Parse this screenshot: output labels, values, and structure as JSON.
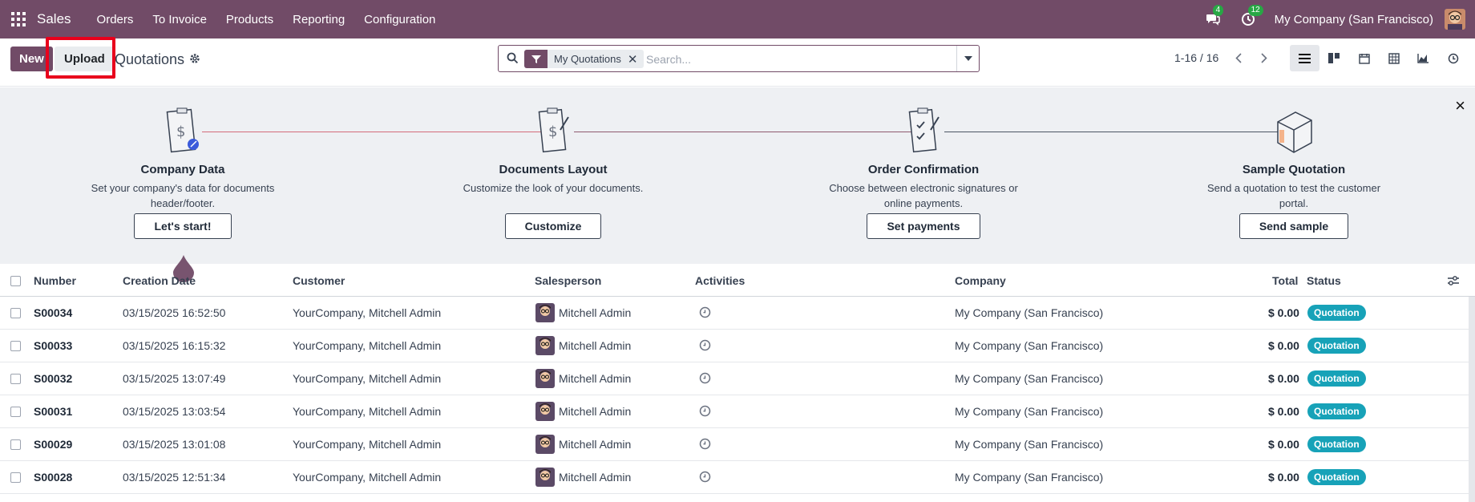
{
  "navbar": {
    "app_name": "Sales",
    "menu": [
      "Orders",
      "To Invoice",
      "Products",
      "Reporting",
      "Configuration"
    ],
    "messages_count": "4",
    "activities_count": "12",
    "company": "My Company (San Francisco)",
    "icons": [
      "apps-grid-icon",
      "chat-icon",
      "clock-icon",
      "avatar"
    ]
  },
  "control": {
    "new_label": "New",
    "upload_label": "Upload",
    "title": "Quotations",
    "search": {
      "facet": "My Quotations",
      "placeholder": "Search..."
    },
    "pager": "1-16 / 16",
    "views": [
      "list-view-icon",
      "kanban-view-icon",
      "calendar-view-icon",
      "pivot-view-icon",
      "graph-view-icon",
      "activity-view-icon"
    ]
  },
  "onboarding": {
    "steps": [
      {
        "title": "Company Data",
        "desc": "Set your company's data for documents header/footer.",
        "button": "Let's start!"
      },
      {
        "title": "Documents Layout",
        "desc": "Customize the look of your documents.",
        "button": "Customize"
      },
      {
        "title": "Order Confirmation",
        "desc": "Choose between electronic signatures or online payments.",
        "button": "Set payments"
      },
      {
        "title": "Sample Quotation",
        "desc": "Send a quotation to test the customer portal.",
        "button": "Send sample"
      }
    ],
    "close": "×"
  },
  "table": {
    "headers": {
      "number": "Number",
      "creation_date": "Creation Date",
      "customer": "Customer",
      "salesperson": "Salesperson",
      "activities": "Activities",
      "company": "Company",
      "total": "Total",
      "status": "Status"
    },
    "rows": [
      {
        "number": "S00034",
        "date": "03/15/2025 16:52:50",
        "customer": "YourCompany, Mitchell Admin",
        "salesperson": "Mitchell Admin",
        "company": "My Company (San Francisco)",
        "total": "$ 0.00",
        "status": "Quotation"
      },
      {
        "number": "S00033",
        "date": "03/15/2025 16:15:32",
        "customer": "YourCompany, Mitchell Admin",
        "salesperson": "Mitchell Admin",
        "company": "My Company (San Francisco)",
        "total": "$ 0.00",
        "status": "Quotation"
      },
      {
        "number": "S00032",
        "date": "03/15/2025 13:07:49",
        "customer": "YourCompany, Mitchell Admin",
        "salesperson": "Mitchell Admin",
        "company": "My Company (San Francisco)",
        "total": "$ 0.00",
        "status": "Quotation"
      },
      {
        "number": "S00031",
        "date": "03/15/2025 13:03:54",
        "customer": "YourCompany, Mitchell Admin",
        "salesperson": "Mitchell Admin",
        "company": "My Company (San Francisco)",
        "total": "$ 0.00",
        "status": "Quotation"
      },
      {
        "number": "S00029",
        "date": "03/15/2025 13:01:08",
        "customer": "YourCompany, Mitchell Admin",
        "salesperson": "Mitchell Admin",
        "company": "My Company (San Francisco)",
        "total": "$ 0.00",
        "status": "Quotation"
      },
      {
        "number": "S00028",
        "date": "03/15/2025 12:51:34",
        "customer": "YourCompany, Mitchell Admin",
        "salesperson": "Mitchell Admin",
        "company": "My Company (San Francisco)",
        "total": "$ 0.00",
        "status": "Quotation"
      }
    ]
  },
  "colors": {
    "brand": "#714B67",
    "badge_success": "#28a745",
    "status_quotation": "#17a2b8",
    "highlight": "#e8001c"
  }
}
